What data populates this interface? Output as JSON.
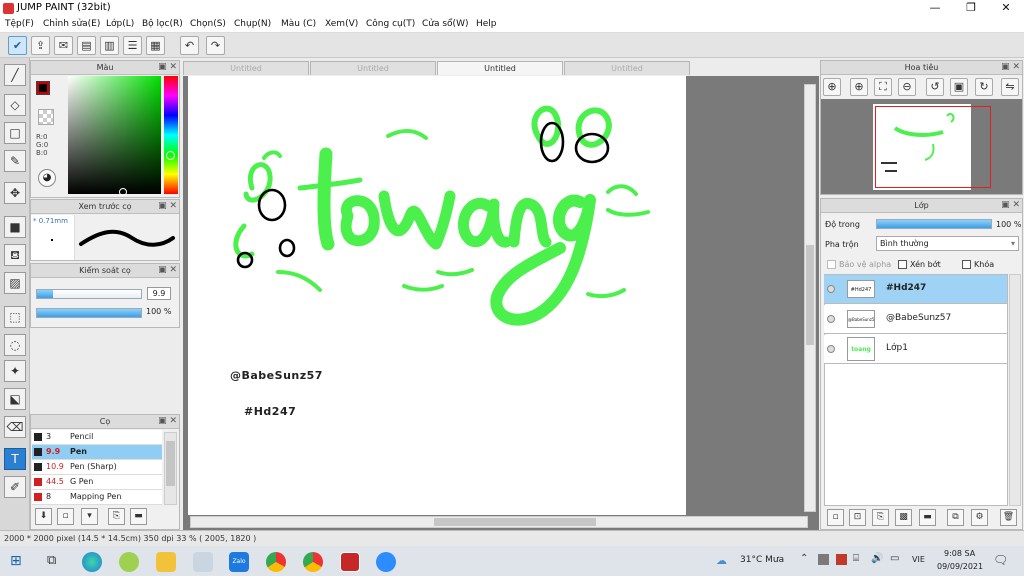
{
  "app": {
    "title": "JUMP PAINT (32bit)"
  },
  "window_controls": {
    "minimize": "—",
    "maximize": "❐",
    "close": "✕"
  },
  "menu": [
    "Tệp(F)",
    "Chỉnh sửa(E)",
    "Lớp(L)",
    "Bộ lọc(R)",
    "Chọn(S)",
    "Chụp(N)",
    "Màu (C)",
    "Xem(V)",
    "Công cụ(T)",
    "Cửa sổ(W)",
    "Help"
  ],
  "tabs": [
    "Untitled",
    "Untitled",
    "Untitled",
    "Untitled"
  ],
  "active_tab_index": 2,
  "color_panel": {
    "title": "Màu",
    "r": "R:0",
    "g": "G:0",
    "b": "B:0",
    "fg_color": "#000000",
    "bg_color": "#ffffff"
  },
  "brush_preview": {
    "title": "Xem trước cọ",
    "size": "* 0.71mm"
  },
  "brush_control": {
    "title": "Kiểm soát cọ",
    "size_value": "9.9",
    "opacity_value": "100 %",
    "size_fraction": 0.15,
    "opacity_fraction": 1.0
  },
  "brush_list": {
    "title": "Cọ",
    "items": [
      {
        "size": "3",
        "name": "Pencil",
        "swatch": "#222222",
        "size_color": "#222222"
      },
      {
        "size": "9.9",
        "name": "Pen",
        "swatch": "#222222",
        "size_color": "#d02020"
      },
      {
        "size": "10.9",
        "name": "Pen (Sharp)",
        "swatch": "#222222",
        "size_color": "#d02020"
      },
      {
        "size": "44.5",
        "name": "G Pen",
        "swatch": "#d02020",
        "size_color": "#d02020"
      },
      {
        "size": "8",
        "name": "Mapping Pen",
        "swatch": "#d02020",
        "size_color": "#222222"
      }
    ],
    "active_index": 1
  },
  "canvas_text": {
    "main_word": "toang",
    "credit": "@BabeSunz57",
    "tag": "#Hd247",
    "stroke_color": "#4cf04c"
  },
  "navigator": {
    "title": "Hoa tiêu"
  },
  "layers_panel": {
    "title": "Lớp",
    "opacity_label": "Độ trong",
    "opacity_value": "100 %",
    "opacity_fraction": 1.0,
    "blend_label": "Pha trộn",
    "blend_value": "Bình thường",
    "protect_alpha": "Bảo vệ alpha",
    "clip": "Xén bớt",
    "lock": "Khóa",
    "layers": [
      {
        "name": "#Hd247",
        "thumb": "#Hd247"
      },
      {
        "name": "@BabeSunz57",
        "thumb": "@BabeSunz57"
      },
      {
        "name": "Lớp1",
        "thumb": "toang"
      }
    ],
    "active_index": 0
  },
  "status": {
    "text": "2000 * 2000 pixel   (14.5 * 14.5cm)   350 dpi   33 %   ( 2005, 1820 )"
  },
  "taskbar": {
    "weather": "31°C  Mưa",
    "lang": "VIE",
    "time": "9:08 SA",
    "date": "09/09/2021",
    "zalo": "Zalo"
  }
}
